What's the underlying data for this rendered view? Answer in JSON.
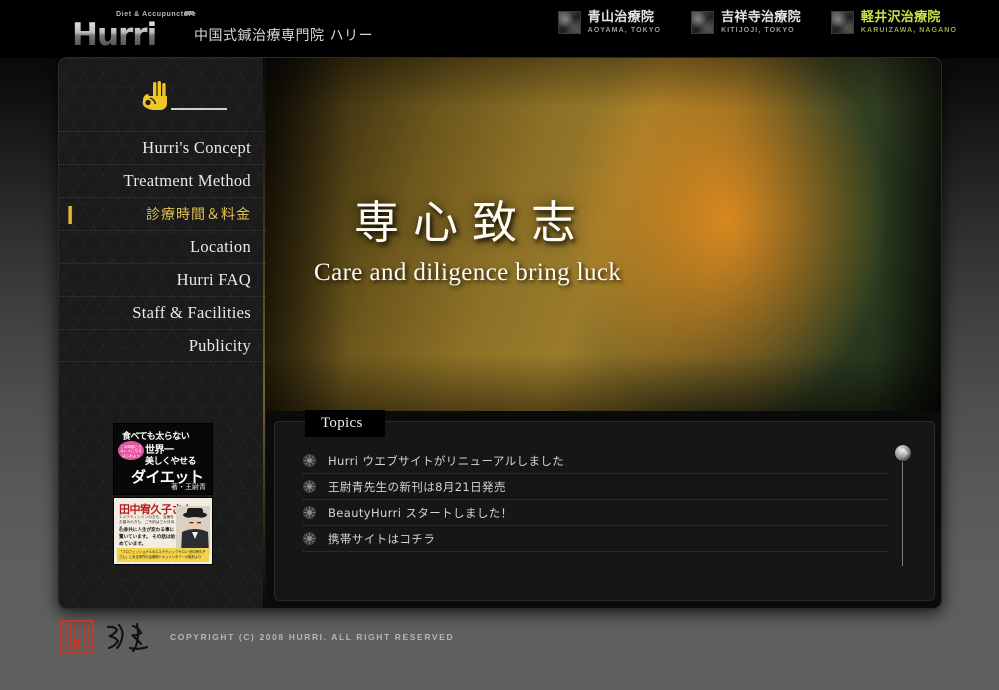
{
  "header": {
    "logo_word": "Hurri",
    "logo_tagline": "Diet & Accupuncture",
    "brand_jp": "中国式鍼治療専門院 ハリー",
    "clinics": [
      {
        "jp": "青山治療院",
        "en": "AOYAMA, TOKYO",
        "accent": false
      },
      {
        "jp": "吉祥寺治療院",
        "en": "KITIJOJI, TOKYO",
        "accent": false
      },
      {
        "jp": "軽井沢治療院",
        "en": "KARUIZAWA, NAGANO",
        "accent": true
      }
    ]
  },
  "sidebar": {
    "hand_icon": "ok-hand-icon",
    "nav": [
      {
        "label": "Hurri's Concept",
        "jp": false,
        "active": false
      },
      {
        "label": "Treatment Method",
        "jp": false,
        "active": false
      },
      {
        "label": "診療時間＆料金",
        "jp": true,
        "active": true
      },
      {
        "label": "Location",
        "jp": false,
        "active": false
      },
      {
        "label": "Hurri FAQ",
        "jp": false,
        "active": false
      },
      {
        "label": "Staff & Facilities",
        "jp": false,
        "active": false
      },
      {
        "label": "Publicity",
        "jp": false,
        "active": false
      }
    ],
    "banner_book": {
      "line1": "食べても太らない",
      "badge": "この時期こそ\nキレイになる\nはじめよう",
      "line2": "世界一",
      "line3": "美しくやせる",
      "line4": "ダイエット",
      "author": "著・王尉青"
    },
    "banner_ad": {
      "title": "田中宥久子さん",
      "sub": "エステティシャンの方も、治療をお望みの方も、ご予約は三か月待ち。",
      "body": "心身共に人生が変わる事に驚いています。\nその話は始めています。",
      "foot": "「プロフェッショナルのエステティックサロン 田中宥久子さん」とある専門の治療院ドキュメンタリーの取材より"
    }
  },
  "hero": {
    "headline_cn": "専心致志",
    "headline_en": "Care and diligence bring luck"
  },
  "topics": {
    "title": "Topics",
    "items": [
      "Hurri ウエブサイトがリニューアルしました",
      "王尉青先生の新刊は8月21日発売",
      "BeautyHurri スタートしました！",
      "携帯サイトはコチラ"
    ],
    "scrollbar": "topics-scrollbar"
  },
  "footer": {
    "copyright": "COPYRIGHT (C) 2008 HURRI. ALL RIGHT RESERVED",
    "seal_icon": "red-seal-icon",
    "calligraphy_icon": "calligraphy-signature-icon"
  },
  "colors": {
    "accent_gold": "#e0c253",
    "accent_green": "#cfe24a",
    "panel_bg": "#0d0d0d",
    "sidebar_bg": "#1b1b1b"
  }
}
